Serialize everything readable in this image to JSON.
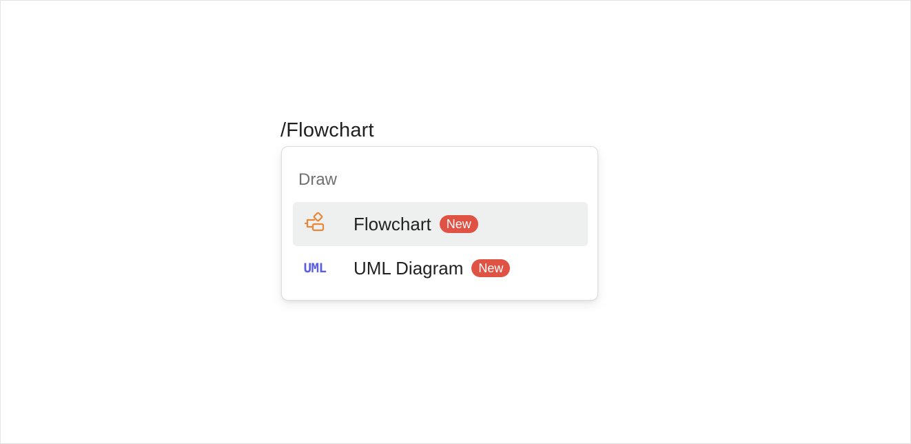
{
  "editor": {
    "command_text": "/Flowchart"
  },
  "menu": {
    "heading": "Draw",
    "items": [
      {
        "label": "Flowchart",
        "badge": "New",
        "icon": "flowchart-icon",
        "icon_color": "#e8873a",
        "selected": true
      },
      {
        "label": "UML Diagram",
        "badge": "New",
        "icon": "uml-icon",
        "icon_text": "UML",
        "icon_color": "#5a5ee0",
        "selected": false
      }
    ]
  },
  "colors": {
    "badge_bg": "#e05243",
    "selected_bg": "#eef0ef",
    "heading_text": "#707070"
  }
}
